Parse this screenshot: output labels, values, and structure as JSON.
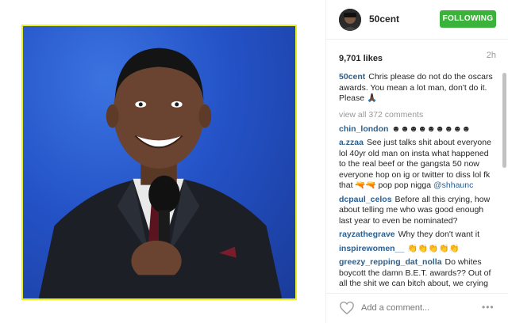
{
  "post": {
    "username": "50cent",
    "follow_label": "FOLLOWING",
    "likes": "9,701 likes",
    "age": "2h",
    "caption_user": "50cent",
    "caption_text": "Chris please do not do the oscars awards. You mean a lot man, don't do it. Please 🙏🏿",
    "view_all": "view all 372 comments",
    "comment_placeholder": "Add a comment...",
    "more_label": "•••"
  },
  "comments": [
    {
      "user": "chin_london",
      "text": "☻☻☻☻☻☻☻☻☻"
    },
    {
      "user": "a.zzaa",
      "text": "See just talks shit about everyone lol 40yr old man on insta what happened to the real beef or the gangsta 50 now everyone hop on ig or twitter to diss lol fk that 🔫🔫 pop pop nigga",
      "mention": "@shhaunc"
    },
    {
      "user": "dcpaul_celos",
      "text": "Before all this crying, how about telling me who was good enough last year to even be nominated?"
    },
    {
      "user": "rayzathegrave",
      "text": "Why they don't want it"
    },
    {
      "user": "inspirewomen__",
      "text": "👏👏👏👏👏"
    },
    {
      "user": "greezy_repping_dat_nolla",
      "text": "Do whites boycott the damn B.E.T. awards?? Out of all the shit we can bitch about, we crying over black actors not getting a famn"
    }
  ],
  "colors": {
    "follow_bg": "#3bb33b",
    "username_link": "#2b5f8e",
    "photo_border": "#e8f21a"
  }
}
